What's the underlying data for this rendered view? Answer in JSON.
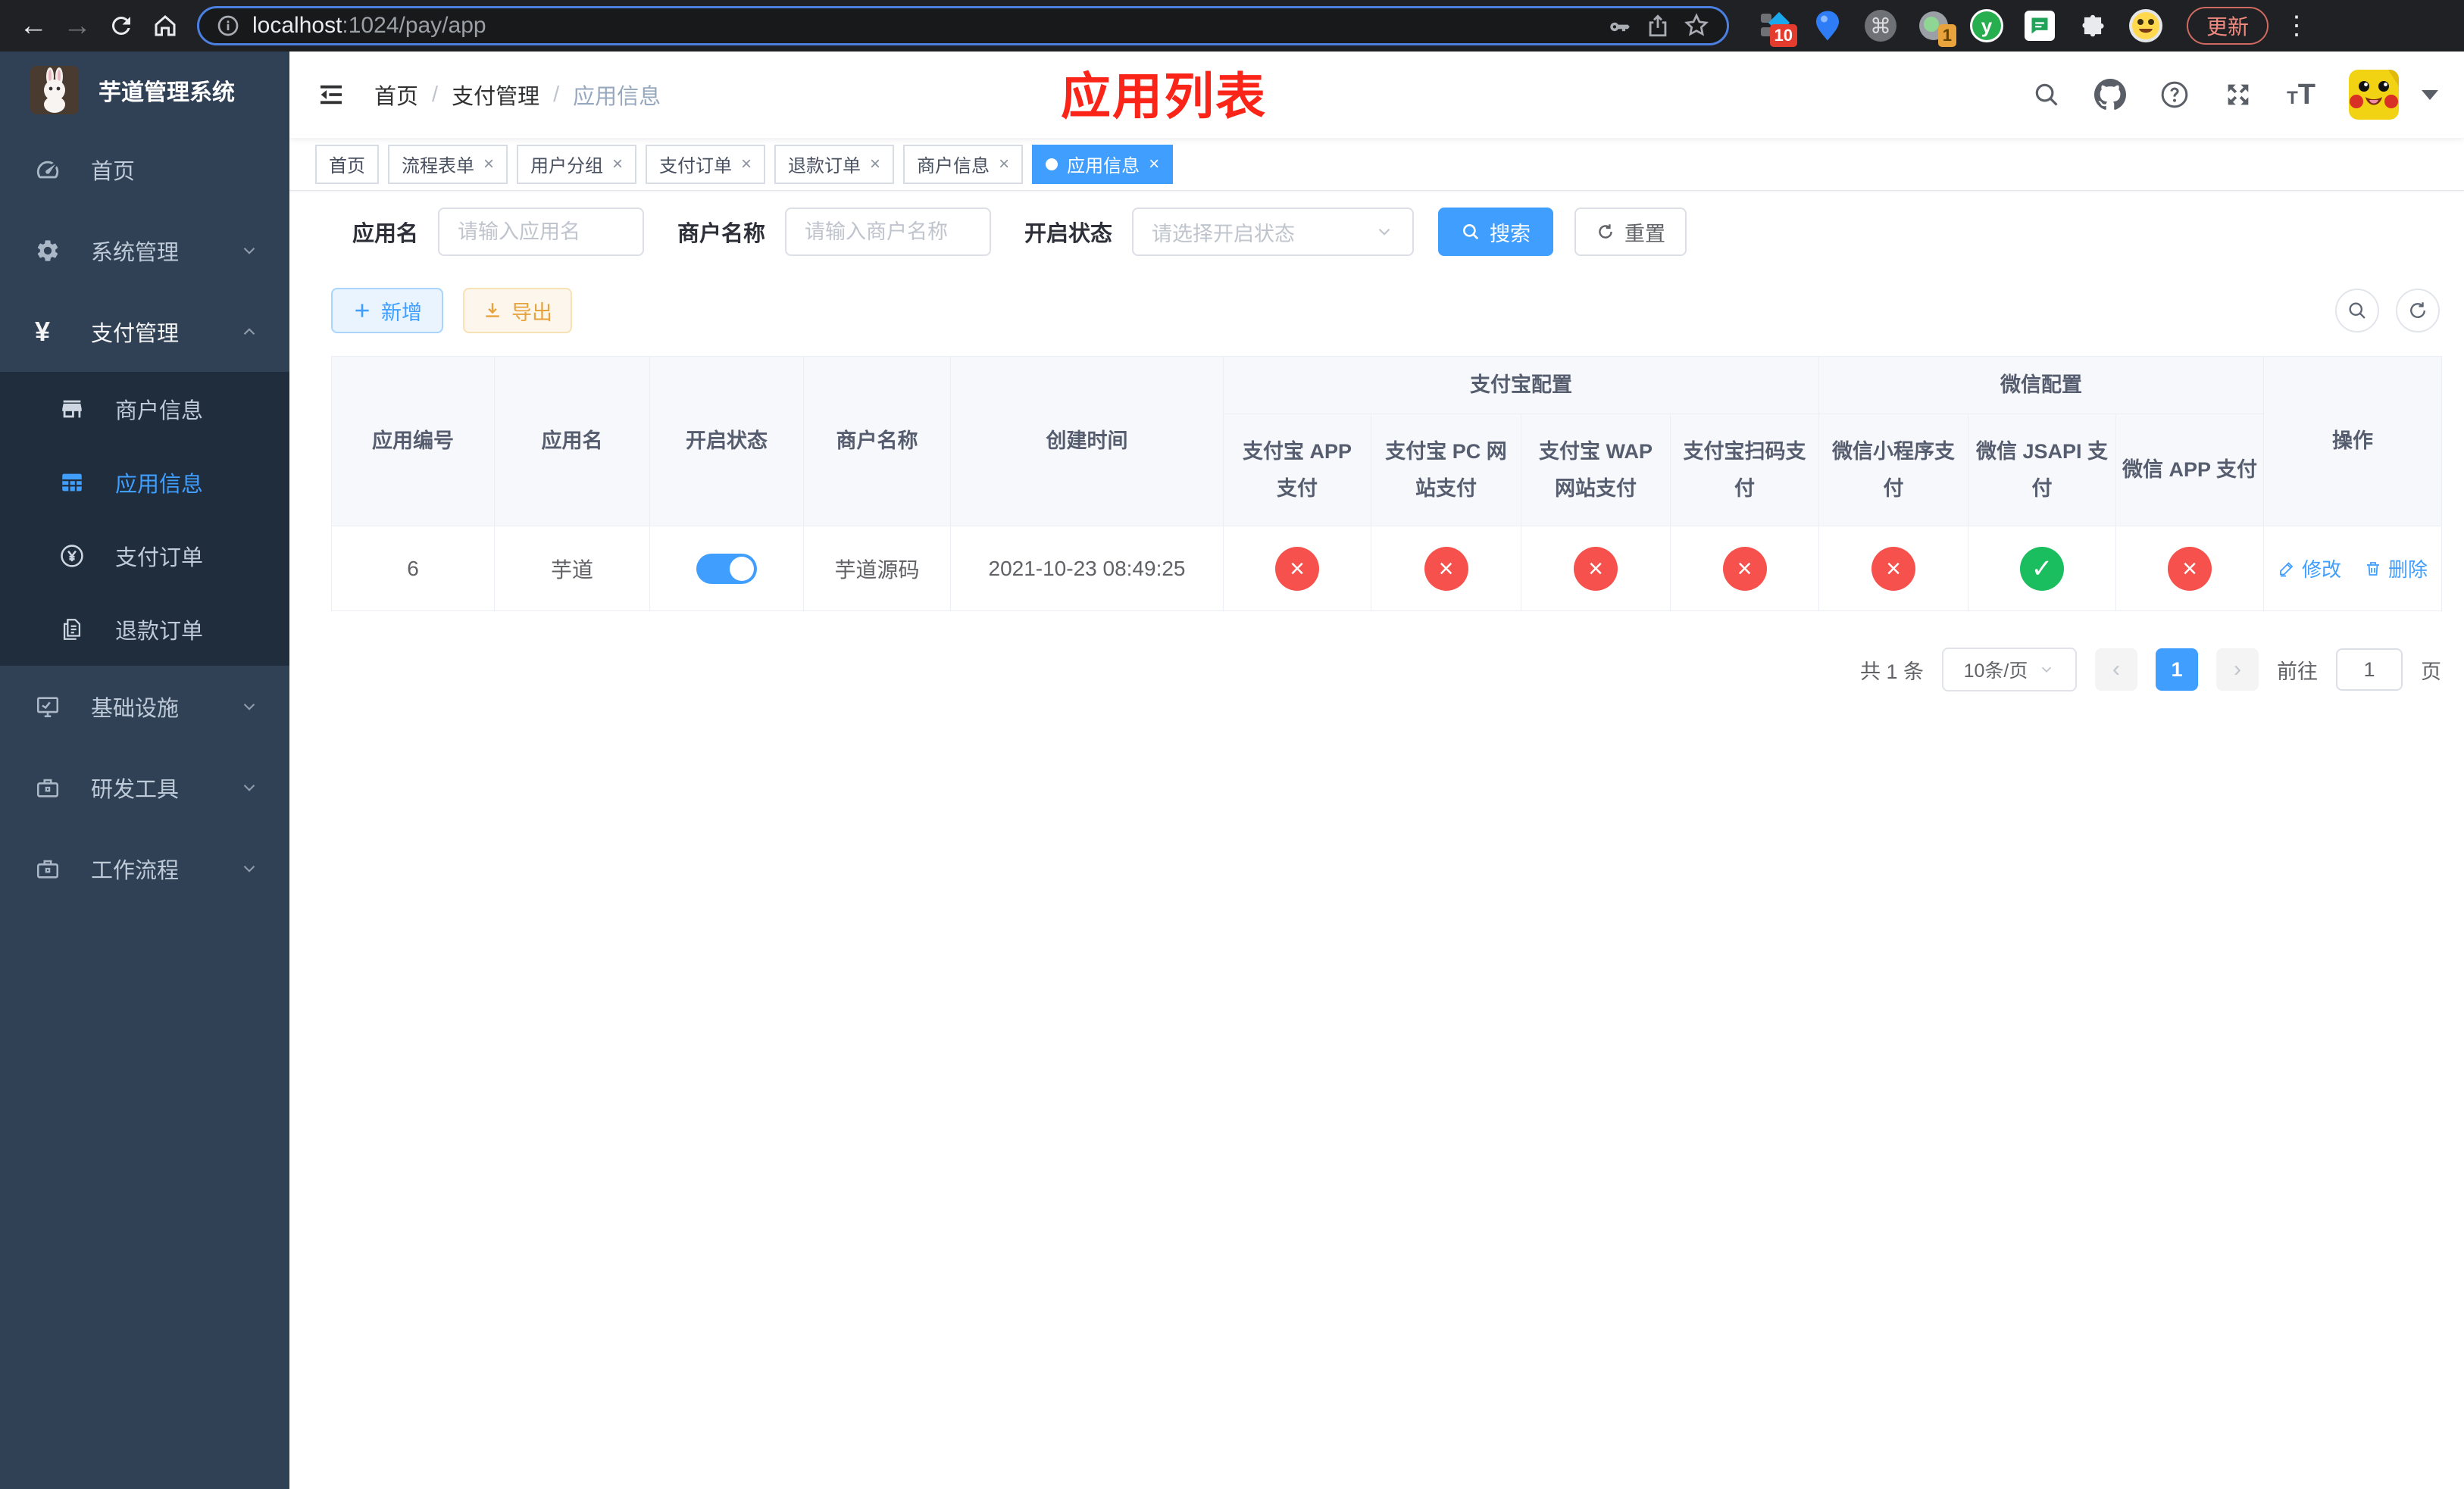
{
  "browser": {
    "url_host": "localhost",
    "url_path": ":1024/pay/app",
    "ext_diamond_badge": "10",
    "ext_circle_badge": "1",
    "ext_y_letter": "y",
    "update_label": "更新"
  },
  "sidebar": {
    "app_title": "芋道管理系统",
    "items": [
      {
        "label": "首页"
      },
      {
        "label": "系统管理"
      },
      {
        "label": "支付管理"
      },
      {
        "label": "基础设施"
      },
      {
        "label": "研发工具"
      },
      {
        "label": "工作流程"
      }
    ],
    "submenu": [
      {
        "label": "商户信息"
      },
      {
        "label": "应用信息"
      },
      {
        "label": "支付订单"
      },
      {
        "label": "退款订单"
      }
    ]
  },
  "header": {
    "breadcrumb": [
      "首页",
      "支付管理",
      "应用信息"
    ],
    "annotation": "应用列表"
  },
  "tabs": [
    {
      "label": "首页"
    },
    {
      "label": "流程表单"
    },
    {
      "label": "用户分组"
    },
    {
      "label": "支付订单"
    },
    {
      "label": "退款订单"
    },
    {
      "label": "商户信息"
    },
    {
      "label": "应用信息"
    }
  ],
  "filters": {
    "app_name_label": "应用名",
    "app_name_placeholder": "请输入应用名",
    "merchant_label": "商户名称",
    "merchant_placeholder": "请输入商户名称",
    "status_label": "开启状态",
    "status_placeholder": "请选择开启状态",
    "search_label": "搜索",
    "reset_label": "重置"
  },
  "toolbar": {
    "add_label": "新增",
    "export_label": "导出"
  },
  "table": {
    "col_app_id": "应用编号",
    "col_app_name": "应用名",
    "col_status": "开启状态",
    "col_merchant": "商户名称",
    "col_created": "创建时间",
    "group_alipay": "支付宝配置",
    "group_wechat": "微信配置",
    "col_alipay_app": "支付宝 APP 支付",
    "col_alipay_pc": "支付宝 PC 网站支付",
    "col_alipay_wap": "支付宝 WAP 网站支付",
    "col_alipay_qr": "支付宝扫码支付",
    "col_wx_mini": "微信小程序支付",
    "col_wx_jsapi": "微信 JSAPI 支付",
    "col_wx_app": "微信 APP 支付",
    "col_ops": "操作",
    "status_glyph_ok": "✓",
    "status_glyph_fail": "×",
    "rows": [
      {
        "app_id": "6",
        "app_name": "芋道",
        "enabled": true,
        "merchant": "芋道源码",
        "created": "2021-10-23 08:49:25",
        "statuses": [
          false,
          false,
          false,
          false,
          false,
          true,
          false
        ],
        "edit_label": "修改",
        "delete_label": "删除"
      }
    ]
  },
  "pagination": {
    "total": "共 1 条",
    "page_size": "10条/页",
    "page": "1",
    "goto_label": "前往",
    "goto_value": "1",
    "page_unit": "页"
  },
  "colors": {
    "accent": "#409eff",
    "danger": "#f7514d",
    "success": "#1abe5f",
    "warning": "#e6a23c",
    "annotation_red": "#fb2418",
    "sidebar_bg": "#304156",
    "submenu_bg": "#1f2d3d"
  }
}
